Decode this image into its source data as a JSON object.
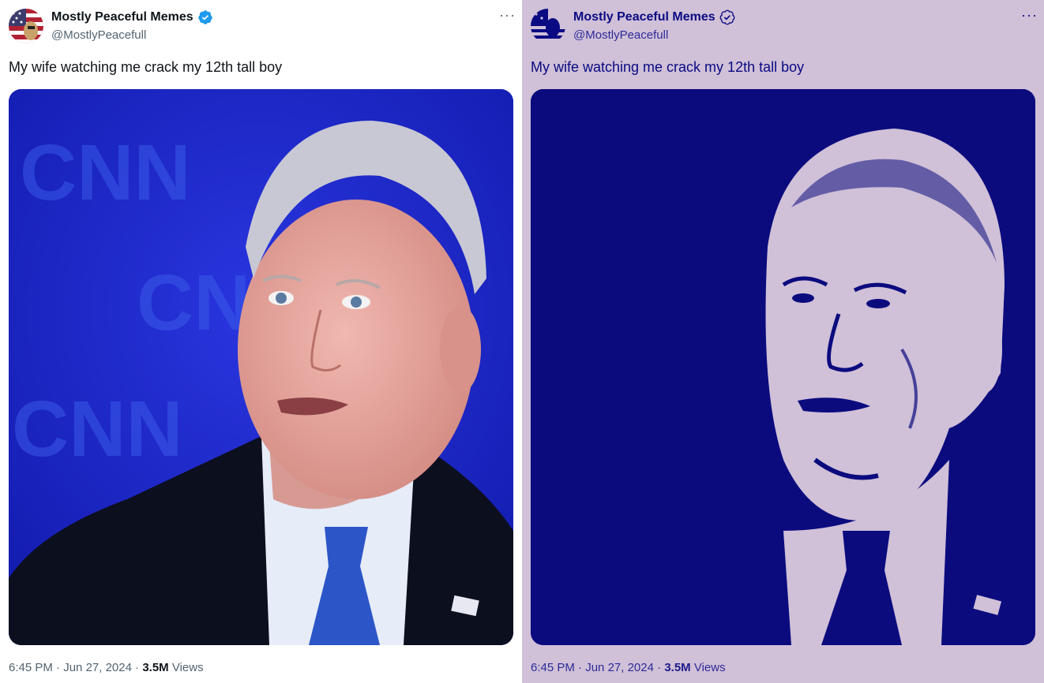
{
  "tweet": {
    "display_name": "Mostly Peaceful Memes",
    "handle": "@MostlyPeacefull",
    "text": "My wife watching me crack my 12th tall boy",
    "time": "6:45 PM",
    "sep1": "·",
    "date": "Jun 27, 2024",
    "sep2": "·",
    "views_count": "3.5M",
    "views_label": " Views",
    "more_glyph": "···"
  },
  "media": {
    "watermark_text": "CNN"
  },
  "icons": {
    "verified": "verified-badge-icon",
    "more": "more-options-icon",
    "avatar": "flag-avatar-icon"
  },
  "colors": {
    "left_bg": "#ffffff",
    "right_bg": "#d0c0d8",
    "verified_blue": "#1d9bf0",
    "cnn_backdrop": "#1a22c8",
    "duotone_dark": "#0b0b7e",
    "duotone_light": "#d0c0d8"
  }
}
